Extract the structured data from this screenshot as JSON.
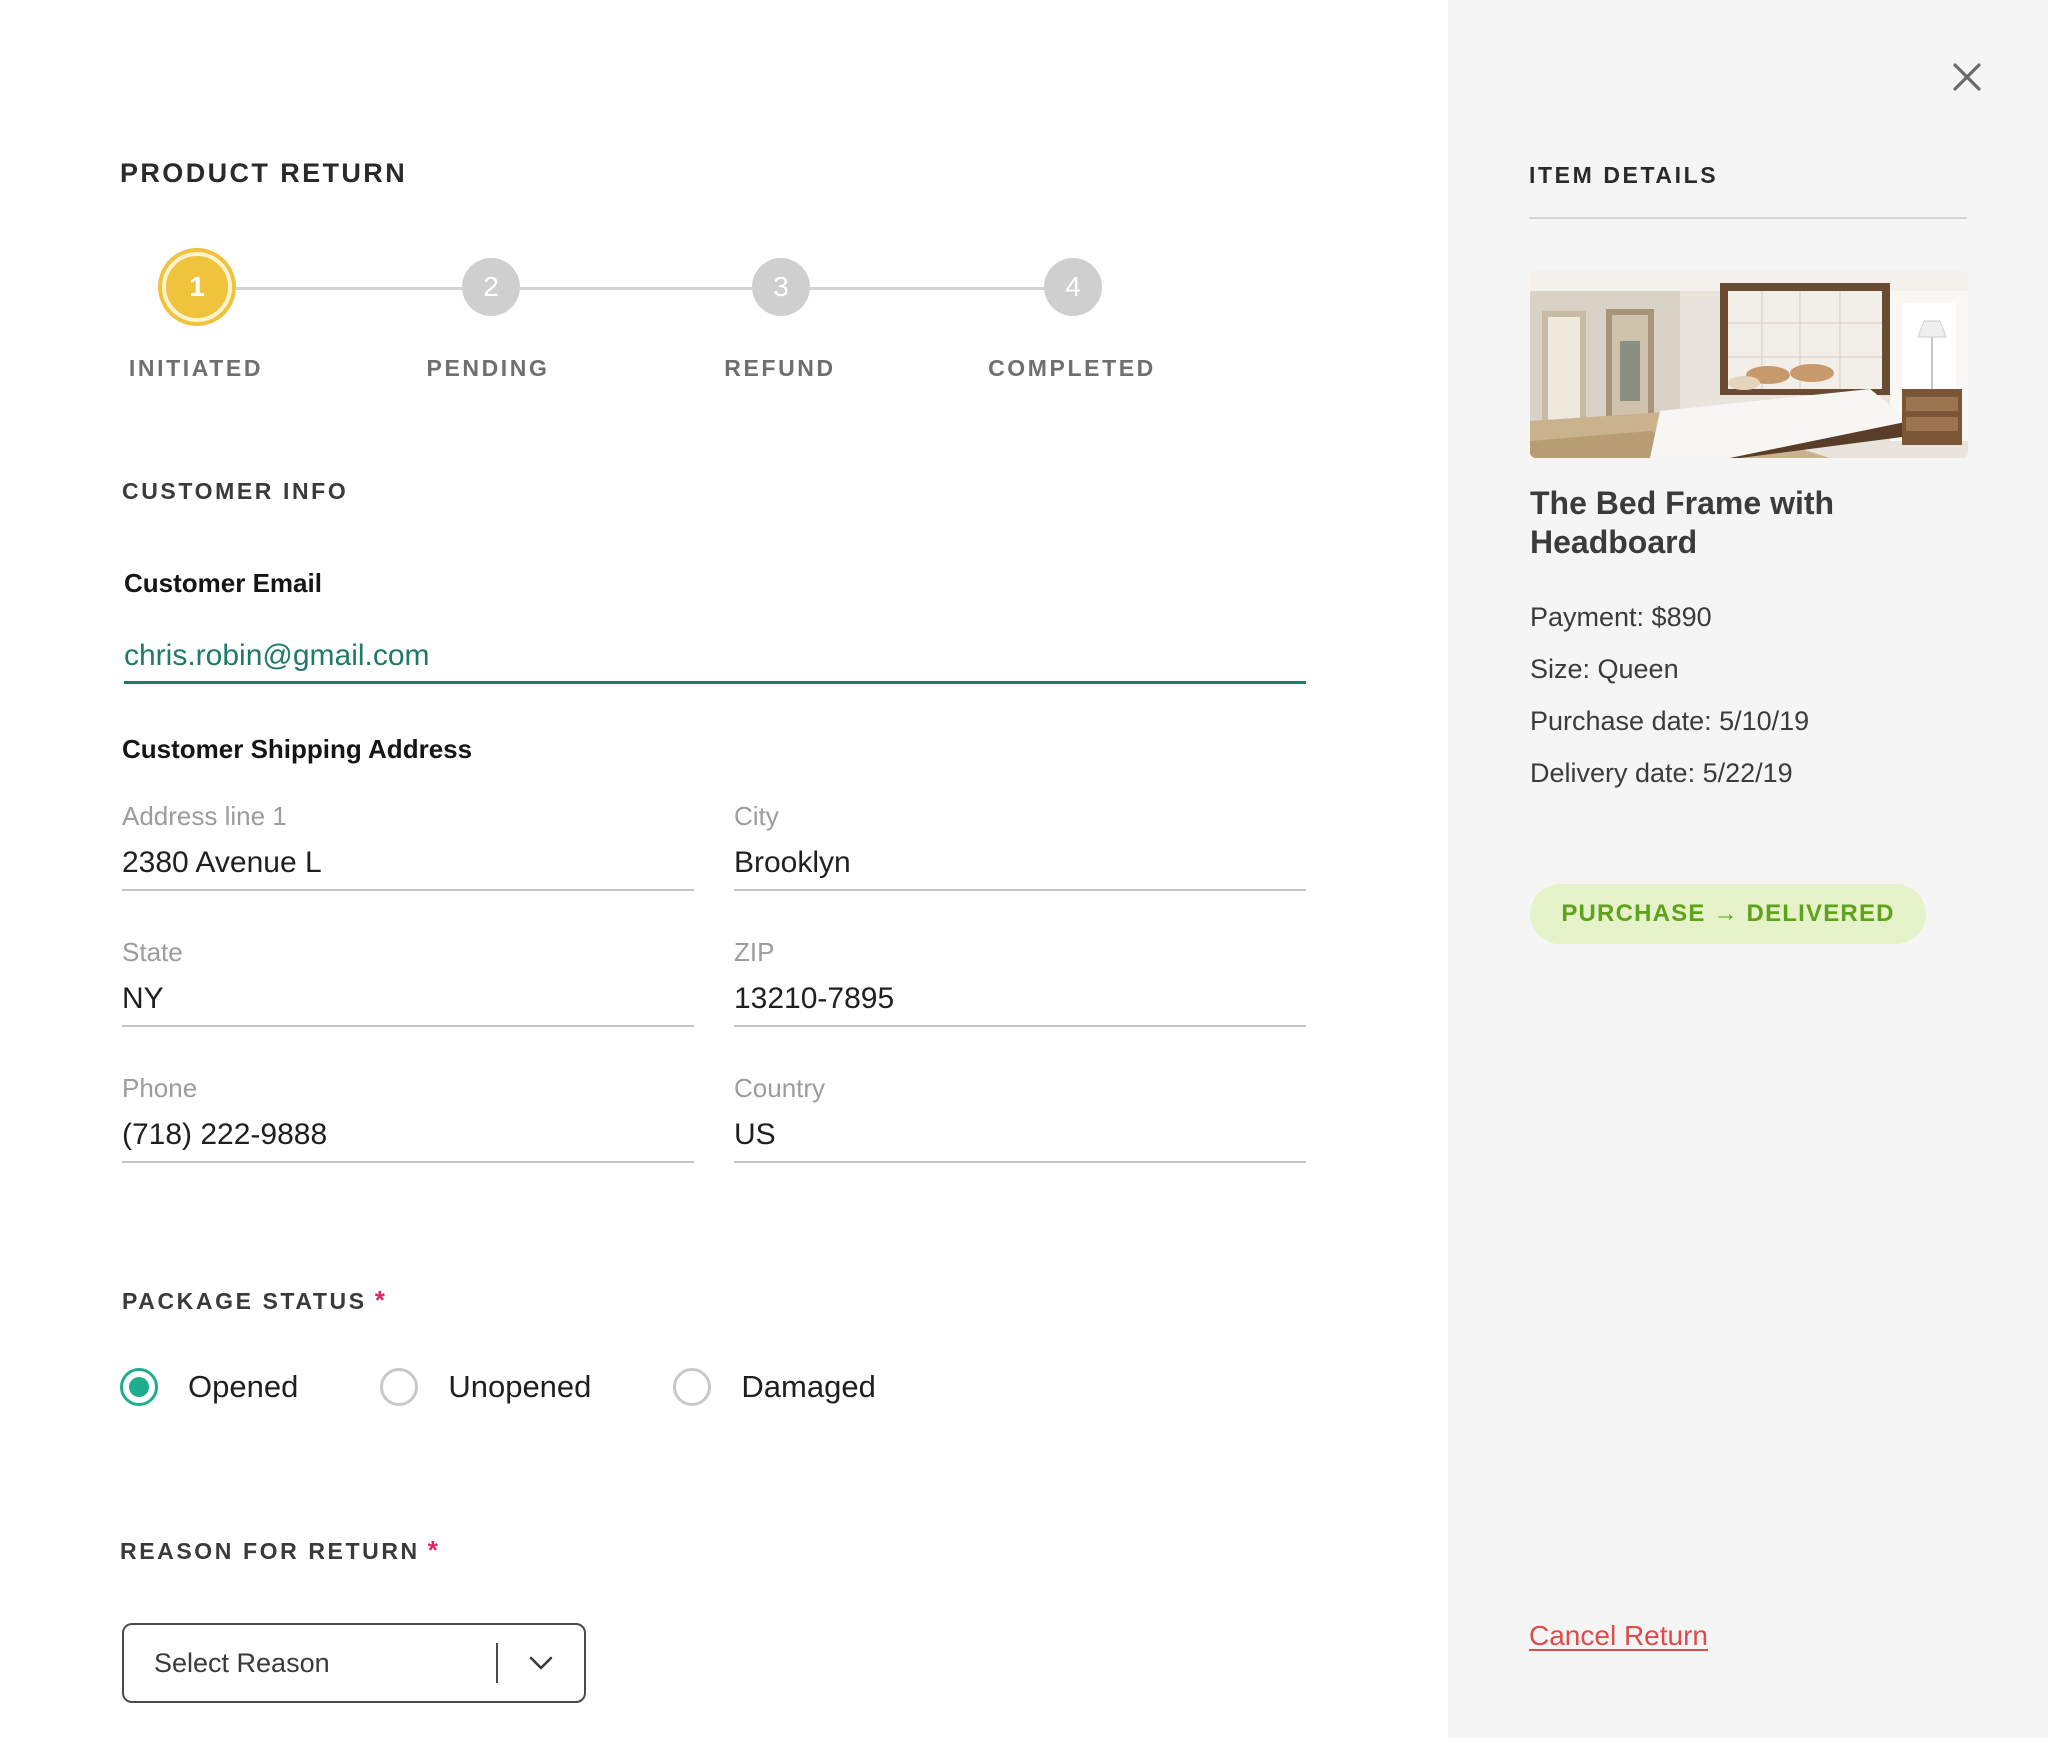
{
  "page": {
    "title": "PRODUCT RETURN"
  },
  "stepper": {
    "steps": [
      {
        "number": "1",
        "label": "INITIATED",
        "active": true
      },
      {
        "number": "2",
        "label": "PENDING",
        "active": false
      },
      {
        "number": "3",
        "label": "REFUND",
        "active": false
      },
      {
        "number": "4",
        "label": "COMPLETED",
        "active": false
      }
    ]
  },
  "customer": {
    "section_title": "CUSTOMER INFO",
    "email_label": "Customer Email",
    "email_value": "chris.robin@gmail.com",
    "address_title": "Customer Shipping Address",
    "fields": {
      "address1": {
        "label": "Address line 1",
        "value": "2380 Avenue L"
      },
      "city": {
        "label": "City",
        "value": "Brooklyn"
      },
      "state": {
        "label": "State",
        "value": "NY"
      },
      "zip": {
        "label": "ZIP",
        "value": "13210-7895"
      },
      "phone": {
        "label": "Phone",
        "value": "(718) 222-9888"
      },
      "country": {
        "label": "Country",
        "value": "US"
      }
    }
  },
  "package_status": {
    "title": "PACKAGE STATUS",
    "required_mark": "*",
    "options": [
      "Opened",
      "Unopened",
      "Damaged"
    ],
    "selected": "Opened"
  },
  "reason": {
    "title": "REASON FOR RETURN",
    "required_mark": "*",
    "placeholder": "Select Reason"
  },
  "item_details": {
    "title": "ITEM DETAILS",
    "product_name": "The Bed Frame with Headboard",
    "payment": "Payment: $890",
    "size": "Size: Queen",
    "purchase_date": "Purchase date: 5/10/19",
    "delivery_date": "Delivery date: 5/22/19",
    "status": "PURCHASE → DELIVERED",
    "cancel_label": "Cancel Return"
  },
  "icons": {
    "close": "close-icon",
    "chevron": "chevron-down-icon"
  },
  "colors": {
    "accent_step": "#f0c33c",
    "email_accent": "#1f7a68",
    "radio_accent": "#1fae8d",
    "required": "#e0245e",
    "status_bg": "#e6f2c9",
    "status_text": "#5fa31a",
    "cancel": "#e14a4a",
    "panel_bg": "#f5f5f5"
  }
}
